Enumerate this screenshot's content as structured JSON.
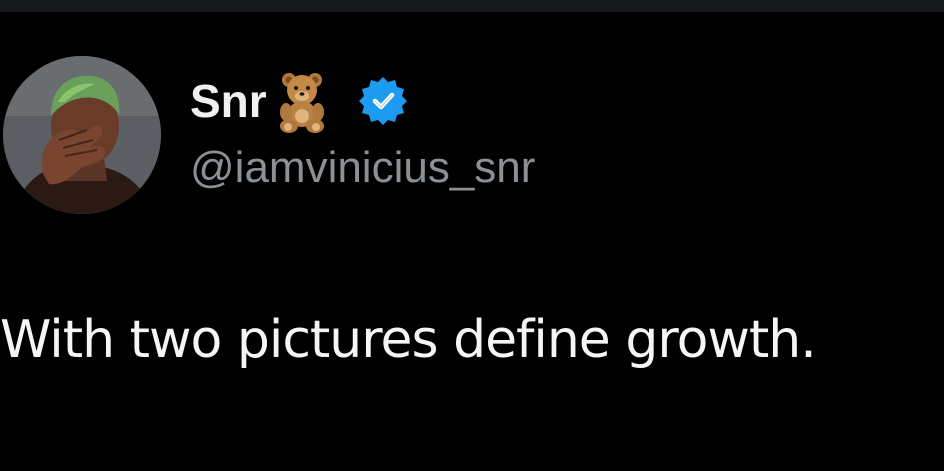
{
  "tweet": {
    "author": {
      "display_name": "Snr",
      "handle": "@iamvinicius_snr",
      "name_emoji_icon": "teddy-bear-icon",
      "verified_icon": "verified-badge-icon",
      "verified_color": "#1d9bf0"
    },
    "text": "With two pictures define growth."
  },
  "colors": {
    "background": "#000000",
    "name_text": "#eef0f1",
    "handle_text": "#8b9095",
    "body_text": "#f4f5f6"
  }
}
